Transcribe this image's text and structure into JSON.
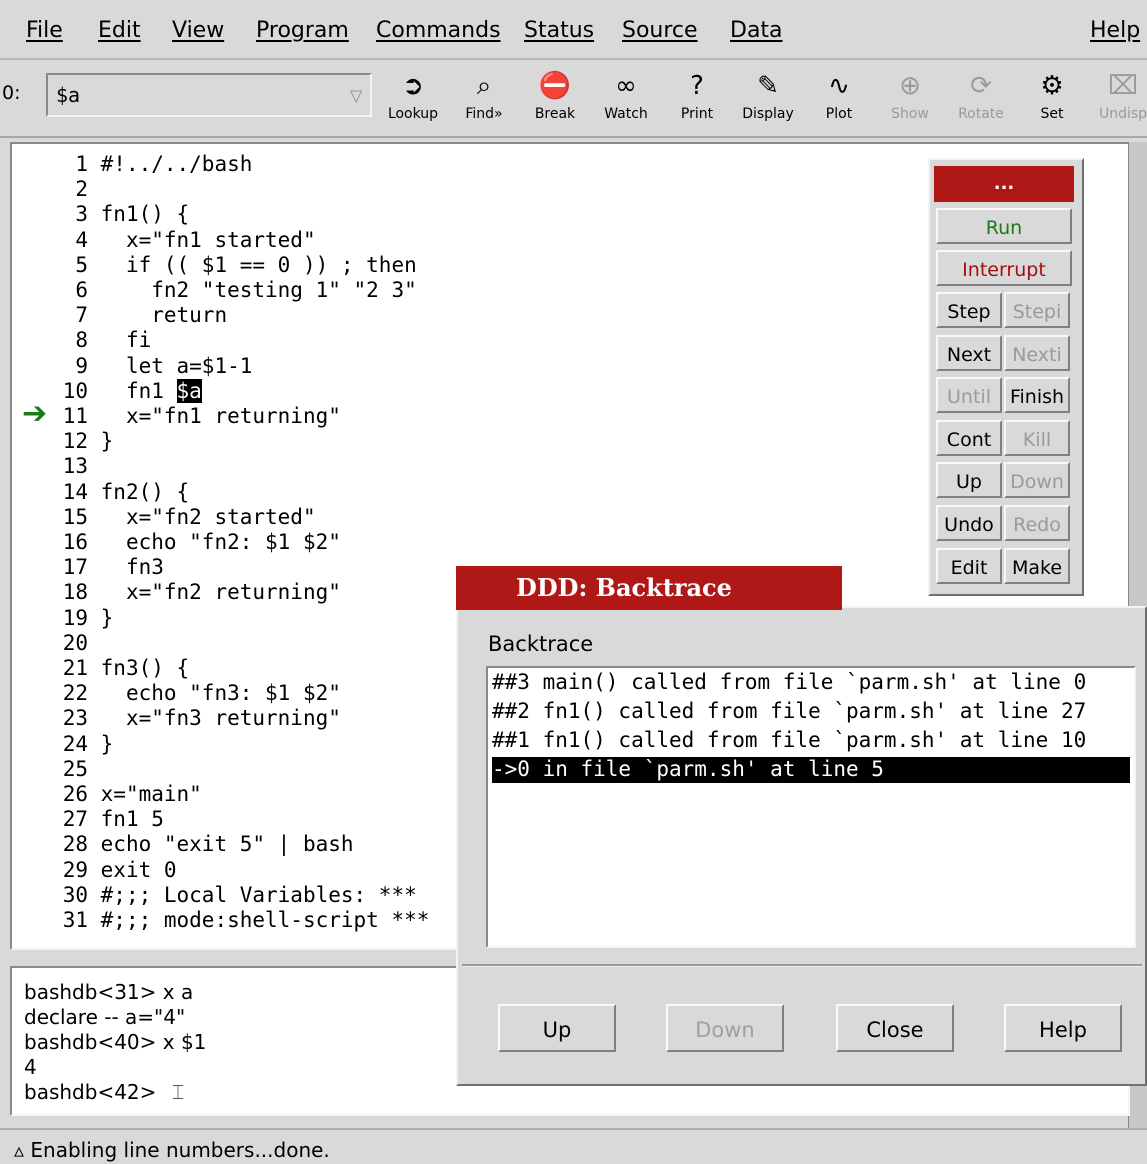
{
  "menubar": [
    "File",
    "Edit",
    "View",
    "Program",
    "Commands",
    "Status",
    "Source",
    "Data",
    "Help"
  ],
  "toolbar": {
    "arg_prefix": "0:",
    "arg_value": "$a",
    "tools": [
      {
        "icon": "lookup-icon",
        "glyph": "➲",
        "label": "Lookup",
        "enabled": true
      },
      {
        "icon": "binoculars-icon",
        "glyph": "⌕",
        "label": "Find»",
        "enabled": true
      },
      {
        "icon": "stop-sign-icon",
        "glyph": "⛔",
        "label": "Break",
        "enabled": true
      },
      {
        "icon": "glasses-icon",
        "glyph": "∞",
        "label": "Watch",
        "enabled": true
      },
      {
        "icon": "question-icon",
        "glyph": "?",
        "label": "Print",
        "enabled": true
      },
      {
        "icon": "display-icon",
        "glyph": "✎",
        "label": "Display",
        "enabled": true
      },
      {
        "icon": "plot-icon",
        "glyph": "∿",
        "label": "Plot",
        "enabled": true
      },
      {
        "icon": "magnifier-icon",
        "glyph": "⊕",
        "label": "Show",
        "enabled": false
      },
      {
        "icon": "rotate-icon",
        "glyph": "⟳",
        "label": "Rotate",
        "enabled": false
      },
      {
        "icon": "set-icon",
        "glyph": "⚙",
        "label": "Set",
        "enabled": true
      },
      {
        "icon": "undisplay-icon",
        "glyph": "⌧",
        "label": "Undisp",
        "enabled": false
      }
    ]
  },
  "source_lines": [
    {
      "n": "1",
      "code": "#!../../bash"
    },
    {
      "n": "2",
      "code": ""
    },
    {
      "n": "3",
      "code": "fn1() {"
    },
    {
      "n": "4",
      "code": "  x=\"fn1 started\""
    },
    {
      "n": "5",
      "code": "  if (( $1 == 0 )) ; then"
    },
    {
      "n": "6",
      "code": "    fn2 \"testing 1\" \"2 3\""
    },
    {
      "n": "7",
      "code": "    return"
    },
    {
      "n": "8",
      "code": "  fi"
    },
    {
      "n": "9",
      "code": "  let a=$1-1"
    },
    {
      "n": "10",
      "code": "  fn1 ",
      "hl": "$a"
    },
    {
      "n": "11",
      "code": "  x=\"fn1 returning\""
    },
    {
      "n": "12",
      "code": "}"
    },
    {
      "n": "13",
      "code": ""
    },
    {
      "n": "14",
      "code": "fn2() {"
    },
    {
      "n": "15",
      "code": "  x=\"fn2 started\""
    },
    {
      "n": "16",
      "code": "  echo \"fn2: $1 $2\""
    },
    {
      "n": "17",
      "code": "  fn3"
    },
    {
      "n": "18",
      "code": "  x=\"fn2 returning\""
    },
    {
      "n": "19",
      "code": "}"
    },
    {
      "n": "20",
      "code": ""
    },
    {
      "n": "21",
      "code": "fn3() {"
    },
    {
      "n": "22",
      "code": "  echo \"fn3: $1 $2\""
    },
    {
      "n": "23",
      "code": "  x=\"fn3 returning\""
    },
    {
      "n": "24",
      "code": "}"
    },
    {
      "n": "25",
      "code": ""
    },
    {
      "n": "26",
      "code": "x=\"main\""
    },
    {
      "n": "27",
      "code": "fn1 5"
    },
    {
      "n": "28",
      "code": "echo \"exit 5\" | bash"
    },
    {
      "n": "29",
      "code": "exit 0"
    },
    {
      "n": "30",
      "code": "#;;; Local Variables: ***"
    },
    {
      "n": "31",
      "code": "#;;; mode:shell-script ***"
    }
  ],
  "console_lines": [
    "bashdb<31> x a",
    "declare -- a=\"4\"",
    "bashdb<40> x $1",
    "4",
    "bashdb<42> "
  ],
  "status_text": "Enabling line numbers...done.",
  "command_tool": {
    "title": "...",
    "run": "Run",
    "interrupt": "Interrupt",
    "grid": [
      [
        {
          "label": "Step",
          "enabled": true
        },
        {
          "label": "Stepi",
          "enabled": false
        }
      ],
      [
        {
          "label": "Next",
          "enabled": true
        },
        {
          "label": "Nexti",
          "enabled": false
        }
      ],
      [
        {
          "label": "Until",
          "enabled": false
        },
        {
          "label": "Finish",
          "enabled": true
        }
      ],
      [
        {
          "label": "Cont",
          "enabled": true
        },
        {
          "label": "Kill",
          "enabled": false
        }
      ],
      [
        {
          "label": "Up",
          "enabled": true
        },
        {
          "label": "Down",
          "enabled": false
        }
      ],
      [
        {
          "label": "Undo",
          "enabled": true
        },
        {
          "label": "Redo",
          "enabled": false
        }
      ],
      [
        {
          "label": "Edit",
          "enabled": true
        },
        {
          "label": "Make",
          "enabled": true
        }
      ]
    ],
    "colors": {
      "run": "#1a7a1a",
      "interrupt": "#a01010",
      "title_bg": "#b01818"
    }
  },
  "backtrace": {
    "window_title": "DDD: Backtrace",
    "label": "Backtrace",
    "rows": [
      {
        "text": "##3 main() called from file `parm.sh' at line 0",
        "selected": false
      },
      {
        "text": "##2 fn1() called from file `parm.sh' at line 27",
        "selected": false
      },
      {
        "text": "##1 fn1() called from file `parm.sh' at line 10",
        "selected": false
      },
      {
        "text": "->0 in file `parm.sh' at line 5",
        "selected": true
      }
    ],
    "buttons": [
      {
        "label": "Up",
        "enabled": true
      },
      {
        "label": "Down",
        "enabled": false
      },
      {
        "label": "Close",
        "enabled": true
      },
      {
        "label": "Help",
        "enabled": true
      }
    ]
  }
}
